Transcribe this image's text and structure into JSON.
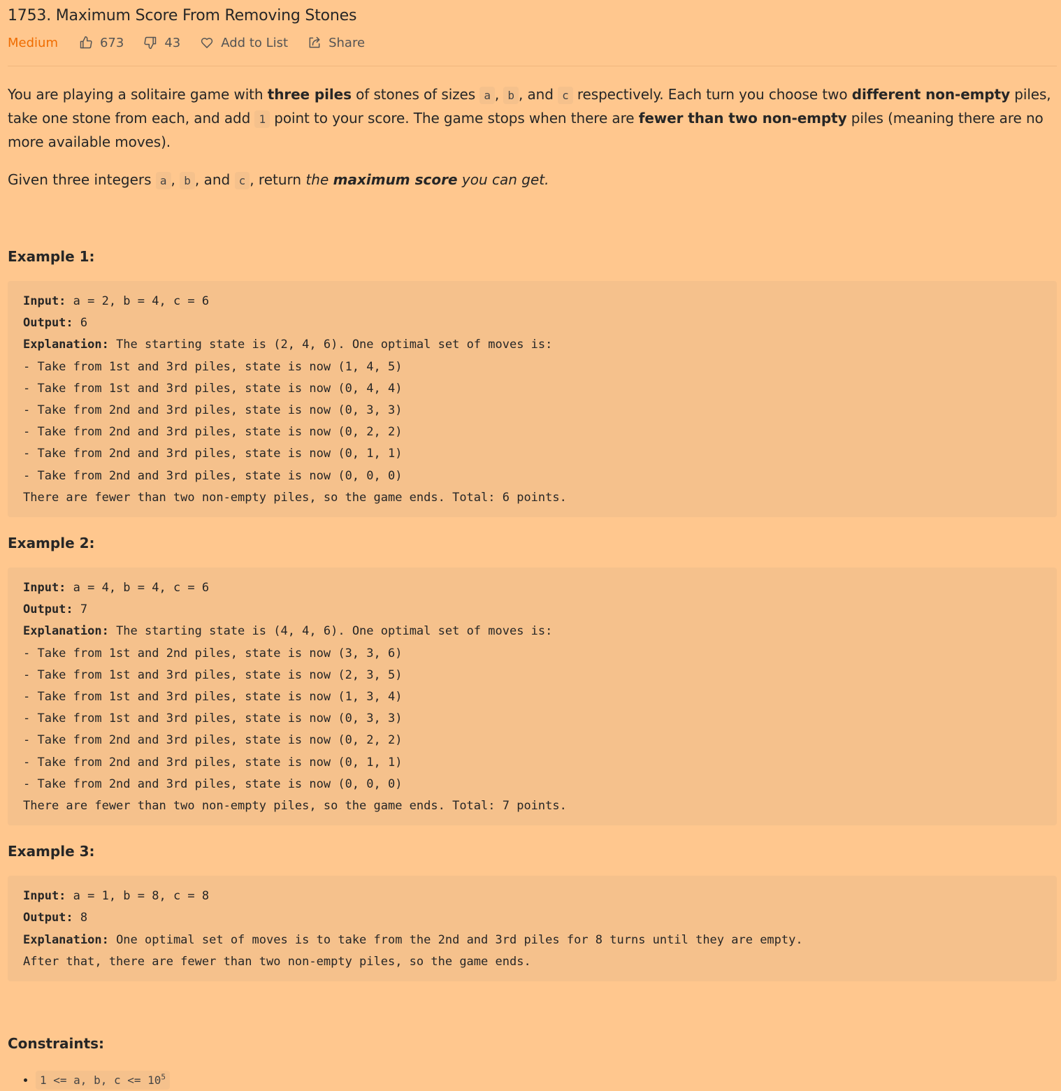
{
  "problem": {
    "title": "1753. Maximum Score From Removing Stones",
    "difficulty": "Medium",
    "likes": "673",
    "dislikes": "43",
    "add_to_list": "Add to List",
    "share": "Share"
  },
  "description": {
    "p1_t1": "You are playing a solitaire game with ",
    "p1_b1": "three piles",
    "p1_t2": " of stones of sizes ",
    "code_a": "a",
    "p1_t3": ", ",
    "code_b": "b",
    "p1_t4": ", and ",
    "code_c": "c",
    "p1_t5": " respectively. Each turn you choose two ",
    "p1_b2": "different non-empty",
    "p1_t6": " piles, take one stone from each, and add ",
    "code_1": "1",
    "p1_t7": " point to your score. The game stops when there are ",
    "p1_b3": "fewer than two non-empty",
    "p1_t8": " piles (meaning there are no more available moves).",
    "p2_t1": "Given three integers ",
    "p2_t2": ", ",
    "p2_t3": ", and ",
    "p2_t4": ", return ",
    "p2_i1": "the ",
    "p2_bi": "maximum score",
    "p2_i2": " you can get."
  },
  "examples": [
    {
      "title": "Example 1:",
      "input_label": "Input:",
      "input": " a = 2, b = 4, c = 6",
      "output_label": "Output:",
      "output": " 6",
      "explanation_label": "Explanation:",
      "explanation": " The starting state is (2, 4, 6). One optimal set of moves is:\n- Take from 1st and 3rd piles, state is now (1, 4, 5)\n- Take from 1st and 3rd piles, state is now (0, 4, 4)\n- Take from 2nd and 3rd piles, state is now (0, 3, 3)\n- Take from 2nd and 3rd piles, state is now (0, 2, 2)\n- Take from 2nd and 3rd piles, state is now (0, 1, 1)\n- Take from 2nd and 3rd piles, state is now (0, 0, 0)\nThere are fewer than two non-empty piles, so the game ends. Total: 6 points."
    },
    {
      "title": "Example 2:",
      "input_label": "Input:",
      "input": " a = 4, b = 4, c = 6",
      "output_label": "Output:",
      "output": " 7",
      "explanation_label": "Explanation:",
      "explanation": " The starting state is (4, 4, 6). One optimal set of moves is:\n- Take from 1st and 2nd piles, state is now (3, 3, 6)\n- Take from 1st and 3rd piles, state is now (2, 3, 5)\n- Take from 1st and 3rd piles, state is now (1, 3, 4)\n- Take from 1st and 3rd piles, state is now (0, 3, 3)\n- Take from 2nd and 3rd piles, state is now (0, 2, 2)\n- Take from 2nd and 3rd piles, state is now (0, 1, 1)\n- Take from 2nd and 3rd piles, state is now (0, 0, 0)\nThere are fewer than two non-empty piles, so the game ends. Total: 7 points."
    },
    {
      "title": "Example 3:",
      "input_label": "Input:",
      "input": " a = 1, b = 8, c = 8",
      "output_label": "Output:",
      "output": " 8",
      "explanation_label": "Explanation:",
      "explanation": " One optimal set of moves is to take from the 2nd and 3rd piles for 8 turns until they are empty.\nAfter that, there are fewer than two non-empty piles, so the game ends."
    }
  ],
  "constraints": {
    "title": "Constraints:",
    "item_1_text": "1 <= a, b, c <= 10",
    "item_1_sup": "5"
  },
  "icons": {
    "like": "thumbs-up-icon",
    "dislike": "thumbs-down-icon",
    "add_to_list": "heart-icon",
    "share": "share-icon"
  },
  "colors": {
    "background": "#ffc78e",
    "difficulty": "#ef6c00",
    "code_bg": "#f5c18c"
  }
}
